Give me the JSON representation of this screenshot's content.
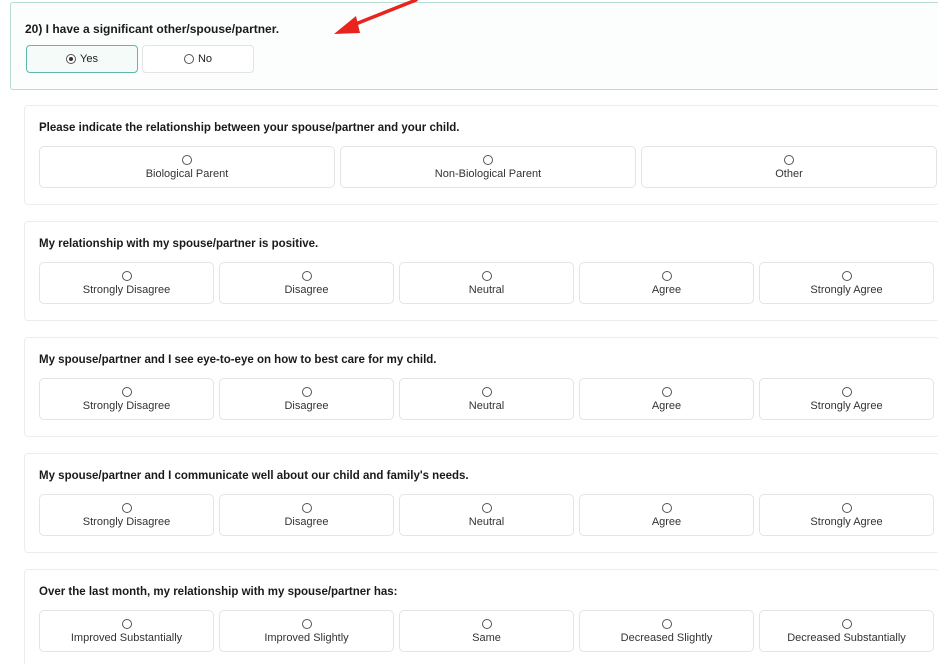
{
  "q20": {
    "label": "20) I have a significant other/spouse/partner.",
    "options": [
      {
        "label": "Yes",
        "selected": true
      },
      {
        "label": "No",
        "selected": false
      }
    ]
  },
  "questions": [
    {
      "label": "Please indicate the relationship between your spouse/partner and your child.",
      "options": [
        "Biological Parent",
        "Non-Biological Parent",
        "Other"
      ]
    },
    {
      "label": "My relationship with my spouse/partner is positive.",
      "options": [
        "Strongly Disagree",
        "Disagree",
        "Neutral",
        "Agree",
        "Strongly Agree"
      ]
    },
    {
      "label": "My spouse/partner and I see eye-to-eye on how to best care for my child.",
      "options": [
        "Strongly Disagree",
        "Disagree",
        "Neutral",
        "Agree",
        "Strongly Agree"
      ]
    },
    {
      "label": "My spouse/partner and I communicate well about our child and family's needs.",
      "options": [
        "Strongly Disagree",
        "Disagree",
        "Neutral",
        "Agree",
        "Strongly Agree"
      ]
    },
    {
      "label": "Over the last month, my relationship with my spouse/partner has:",
      "options": [
        "Improved Substantially",
        "Improved Slightly",
        "Same",
        "Decreased Slightly",
        "Decreased Substantially"
      ]
    }
  ],
  "colors": {
    "accent_border": "#5fb8a8",
    "annotation_arrow": "#e8241c"
  }
}
